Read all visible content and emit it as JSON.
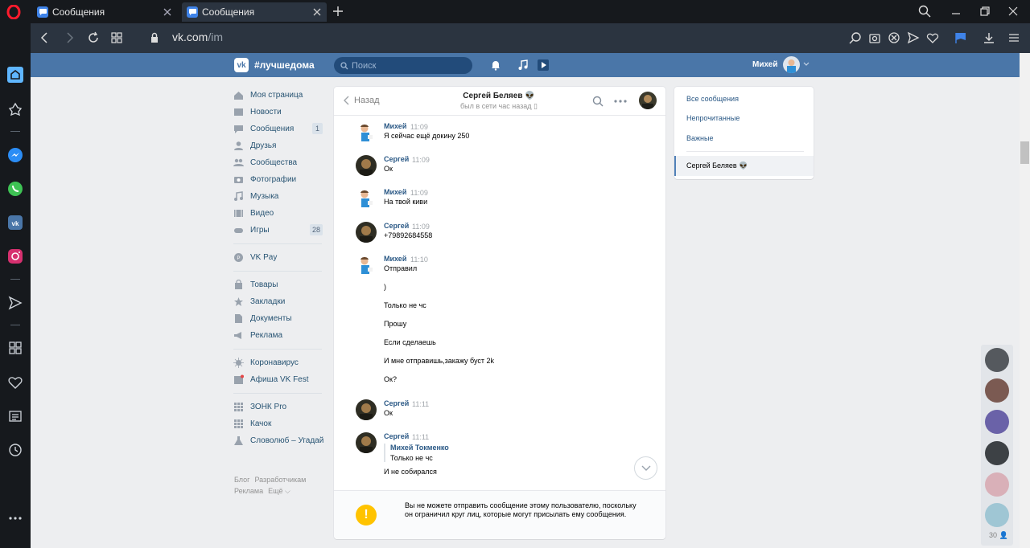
{
  "browser": {
    "tabs": [
      {
        "label": "Сообщения",
        "active": false
      },
      {
        "label": "Сообщения",
        "active": true
      }
    ],
    "url_host": "vk.com",
    "url_path": "/im"
  },
  "vk": {
    "hashtag": "#лучшедома",
    "search_placeholder": "Поиск",
    "user_name": "Михей"
  },
  "menu": {
    "items": [
      {
        "label": "Моя страница",
        "icon": "home-icon",
        "count": ""
      },
      {
        "label": "Новости",
        "icon": "news-icon",
        "count": ""
      },
      {
        "label": "Сообщения",
        "icon": "messages-icon",
        "count": "1"
      },
      {
        "label": "Друзья",
        "icon": "friends-icon",
        "count": ""
      },
      {
        "label": "Сообщества",
        "icon": "groups-icon",
        "count": ""
      },
      {
        "label": "Фотографии",
        "icon": "camera-icon",
        "count": ""
      },
      {
        "label": "Музыка",
        "icon": "music-icon",
        "count": ""
      },
      {
        "label": "Видео",
        "icon": "video-icon",
        "count": ""
      },
      {
        "label": "Игры",
        "icon": "gamepad-icon",
        "count": "28"
      }
    ],
    "pay": [
      {
        "label": "VK Pay",
        "icon": "vkpay-icon"
      }
    ],
    "items2": [
      {
        "label": "Товары",
        "icon": "bag-icon"
      },
      {
        "label": "Закладки",
        "icon": "star-icon"
      },
      {
        "label": "Документы",
        "icon": "document-icon"
      },
      {
        "label": "Реклама",
        "icon": "megaphone-icon"
      }
    ],
    "items3": [
      {
        "label": "Коронавирус",
        "icon": "virus-icon"
      },
      {
        "label": "Афиша VK Fest",
        "icon": "calendar-icon"
      }
    ],
    "apps": [
      {
        "label": "ЗОНК Pro",
        "icon": "apps-icon"
      },
      {
        "label": "Качок",
        "icon": "apps-icon"
      },
      {
        "label": "Словолюб – Угадай",
        "icon": "flask-icon"
      }
    ],
    "footer": [
      "Блог",
      "Разработчикам",
      "Реклама",
      "Ещё ⌵"
    ]
  },
  "chat": {
    "back_label": "Назад",
    "peer_name": "Сергей Беляев 👽",
    "peer_status": "был в сети час назад",
    "messages": [
      {
        "author": "Михей",
        "time": "11:09",
        "lines": [
          "Я сейчас ещё докину 250"
        ]
      },
      {
        "author": "Сергей",
        "time": "11:09",
        "lines": [
          "Ок"
        ]
      },
      {
        "author": "Михей",
        "time": "11:09",
        "lines": [
          "На твой киви"
        ]
      },
      {
        "author": "Сергей",
        "time": "11:09",
        "lines": [
          "+79892684558"
        ]
      },
      {
        "author": "Михей",
        "time": "11:10",
        "lines": [
          "Отправил",
          ")",
          "Только не чс",
          "Прошу",
          "Если сделаешь",
          "И мне отправишь,закажу буст 2k",
          "Ок?"
        ]
      },
      {
        "author": "Сергей",
        "time": "11:11",
        "lines": [
          "Ок"
        ]
      },
      {
        "author": "Сергей",
        "time": "11:11",
        "lines": [
          "И не собирался"
        ],
        "forward": {
          "name": "Михей Токменко",
          "text": "Только не чс"
        }
      }
    ],
    "blocked_notice": "Вы не можете отправить сообщение этому пользователю, поскольку он ограничил круг лиц, которые могут присылать ему сообщения."
  },
  "filters": {
    "items": [
      "Все сообщения",
      "Непрочитанные",
      "Важные"
    ],
    "selected": "Сергей Беляев 👽"
  },
  "friends_online_count": "30"
}
